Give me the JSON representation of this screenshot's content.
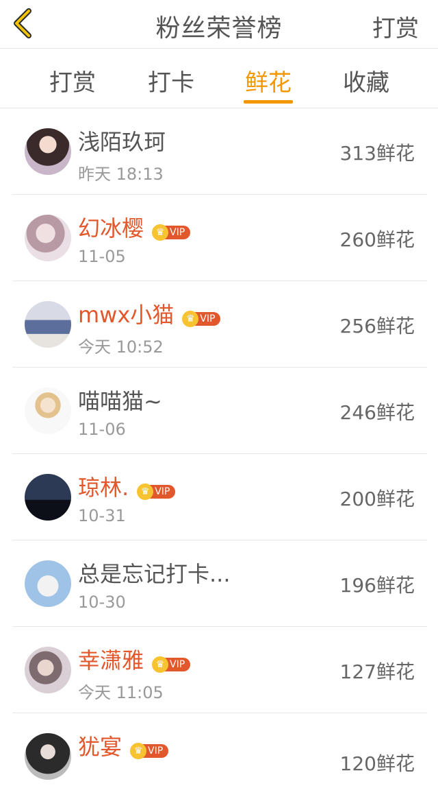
{
  "header": {
    "title": "粉丝荣誉榜",
    "action": "打赏",
    "back_icon": "chevron-left-icon",
    "accent": "#f39800"
  },
  "tabs": [
    {
      "label": "打赏"
    },
    {
      "label": "打卡"
    },
    {
      "label": "鲜花",
      "active": true
    },
    {
      "label": "收藏"
    }
  ],
  "fans": [
    {
      "name": "浅陌玖珂",
      "vip": false,
      "time": "昨天 18:13",
      "score": "313鲜花"
    },
    {
      "name": "幻冰樱",
      "vip": true,
      "vip_label": "VIP",
      "time": "11-05",
      "score": "260鲜花"
    },
    {
      "name": "mwx小猫",
      "vip": true,
      "vip_label": "VIP",
      "time": "今天 10:52",
      "score": "256鲜花"
    },
    {
      "name": "喵喵猫~",
      "vip": false,
      "time": "11-06",
      "score": "246鲜花"
    },
    {
      "name": "琼林.",
      "vip": true,
      "vip_label": "VIP",
      "time": "10-31",
      "score": "200鲜花"
    },
    {
      "name": "总是忘记打卡...",
      "vip": false,
      "time": "10-30",
      "score": "196鲜花"
    },
    {
      "name": "幸潇雅",
      "vip": true,
      "vip_label": "VIP",
      "time": "今天 11:05",
      "score": "127鲜花"
    },
    {
      "name": "犹宴",
      "vip": true,
      "vip_label": "VIP",
      "time": "",
      "score": "120鲜花"
    }
  ],
  "colors": {
    "vip_name": "#e2572b",
    "crown": "#f7c331"
  }
}
